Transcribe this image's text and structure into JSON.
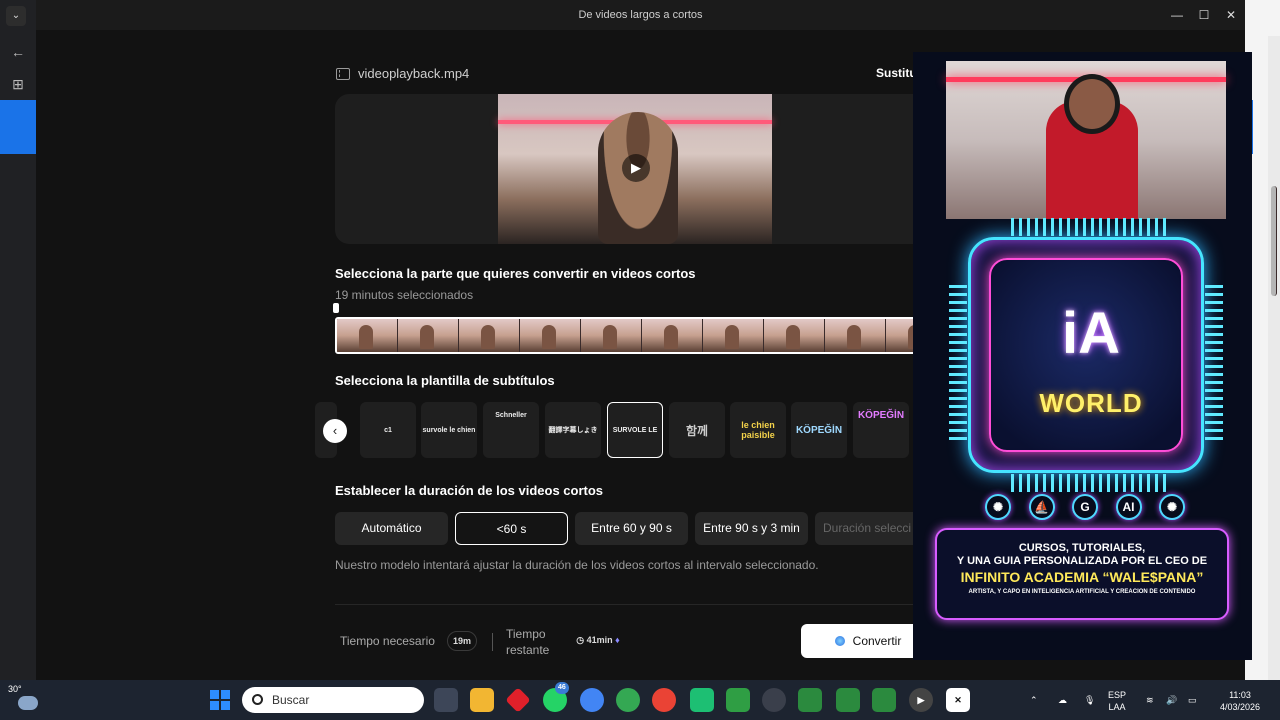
{
  "window": {
    "title": "De videos largos a cortos",
    "minimize": "—",
    "maximize": "☐",
    "close": "✕",
    "tab_menu": "⌄"
  },
  "browser": {
    "back_icon": "←",
    "apps_icon": "⊞"
  },
  "file": {
    "name": "videoplayback.mp4",
    "replace_label": "Sustitu"
  },
  "sections": {
    "select_part": "Selecciona la parte que quieres convertir en videos cortos",
    "selected_minutes": "19 minutos seleccionados",
    "subtitle_template": "Selecciona la plantilla de subtítulos",
    "duration": "Establecer la duración de los videos cortos",
    "duration_hint": "Nuestro modelo intentará ajustar la duración de los videos cortos al intervalo seleccionado."
  },
  "templates": [
    {
      "label": "c1"
    },
    {
      "label": "survole le chien"
    },
    {
      "label": "Schneller"
    },
    {
      "label": "翻譯字幕しょき"
    },
    {
      "label": "SURVOLE LE",
      "selected": true
    },
    {
      "label": "함께"
    },
    {
      "label": "le chien paisible"
    },
    {
      "label": "KÖPEĞİN"
    },
    {
      "label": "KÖPEĞİN"
    }
  ],
  "durations": [
    {
      "label": "Automático"
    },
    {
      "label": "<60 s",
      "selected": true
    },
    {
      "label": "Entre 60 y 90 s"
    },
    {
      "label": "Entre 90 s y 3 min"
    },
    {
      "label": "Duración selecci",
      "disabled": true
    }
  ],
  "footer": {
    "time_needed_label": "Tiempo necesario",
    "time_needed_value": "19m",
    "time_left_label_1": "Tiempo",
    "time_left_label_2": "restante",
    "time_left_value": "41min",
    "convert_label": "Convertir"
  },
  "promo": {
    "logo_text": "iA",
    "world_text": "WORLD",
    "icons": [
      "✺",
      "⛵",
      "G",
      "AI",
      "✺"
    ],
    "line1": "CURSOS, TUTORIALES,",
    "line2": "Y UNA GUIA PERSONALIZADA POR EL CEO DE",
    "line3": "INFINITO ACADEMIA “WALE$PANA”",
    "line4": "ARTISTA, Y CAPO EN INTELIGENCIA ARTIFICIAL Y CREACION DE CONTENIDO"
  },
  "taskbar": {
    "temperature": "30°",
    "search_placeholder": "Buscar",
    "whatsapp_badge": "46",
    "lang_1": "ESP",
    "lang_2": "LAA",
    "time": "11:03",
    "date": "4/03/2026"
  }
}
